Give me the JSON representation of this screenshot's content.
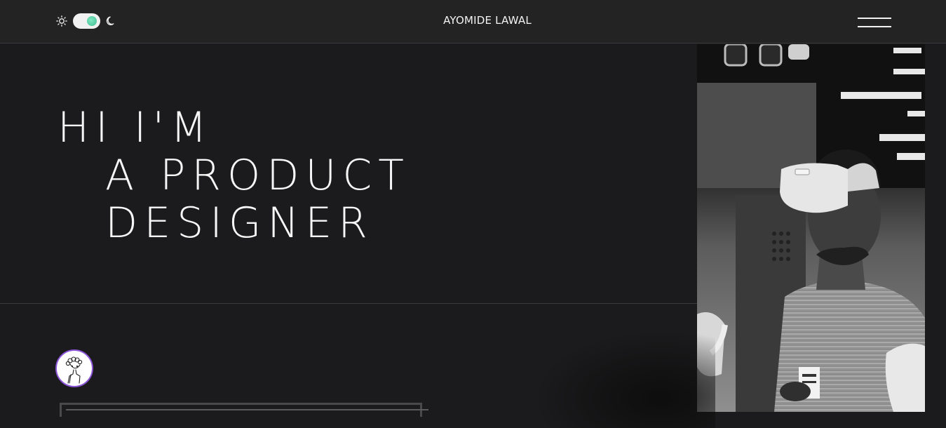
{
  "header": {
    "brand": "AYOMIDE LAWAL",
    "theme": {
      "light_icon": "sun-icon",
      "dark_icon": "moon-icon",
      "toggle_state": "dark",
      "toggle_knob_color": "#3fbf94"
    },
    "menu_icon": "hamburger-icon"
  },
  "hero": {
    "line1": "Hi I'm",
    "line2": "a Product",
    "line3": "Designer"
  },
  "photo": {
    "description_icon": "portrait-photo"
  },
  "avatar": {
    "icon": "person-doodle-icon",
    "border_color": "#8a55d6"
  },
  "colors": {
    "background": "#1b1a1c",
    "header_bg": "#232323",
    "text": "#f2f2f2"
  }
}
